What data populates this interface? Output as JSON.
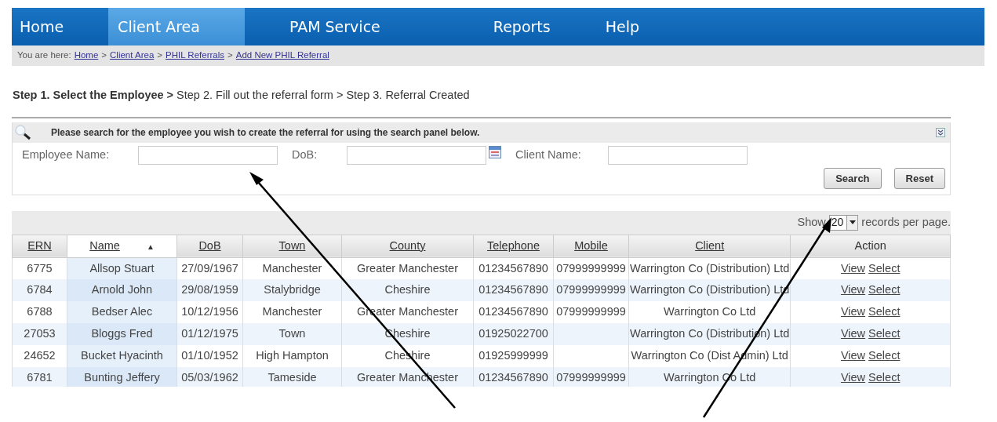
{
  "nav": [
    {
      "label": "Home",
      "selected": false
    },
    {
      "label": "Client Area",
      "selected": true
    },
    {
      "label": "PAM Service",
      "selected": false
    },
    {
      "label": "Reports",
      "selected": false
    },
    {
      "label": "Help",
      "selected": false
    }
  ],
  "breadcrumb": {
    "prefix": "You are here:",
    "separator": ">",
    "links": [
      "Home",
      "Client Area",
      "PHIL Referrals",
      "Add New PHIL Referral"
    ]
  },
  "steps": [
    {
      "label": "Step 1. Select the Employee",
      "current": true
    },
    {
      "label": "Step 2. Fill out the referral form",
      "current": false
    },
    {
      "label": "Step 3. Referral Created",
      "current": false
    }
  ],
  "step_separator": ">",
  "search_panel": {
    "title": "Please search for the employee you wish to create the referral for using the search panel below.",
    "fields": [
      {
        "label": "Employee Name:",
        "kind": "text"
      },
      {
        "label": "DoB:",
        "kind": "date"
      },
      {
        "label": "Client Name:",
        "kind": "text"
      }
    ],
    "buttons": [
      "Search",
      "Reset"
    ]
  },
  "paging": {
    "prefix": "Show",
    "value": "20",
    "suffix": "records per page."
  },
  "table": {
    "columns": [
      {
        "label": "ERN",
        "sorted": false,
        "link": true
      },
      {
        "label": "Name",
        "sorted": true,
        "sort_indicator": "▲",
        "link": true
      },
      {
        "label": "DoB",
        "sorted": false,
        "link": true
      },
      {
        "label": "Town",
        "sorted": false,
        "link": true
      },
      {
        "label": "County",
        "sorted": false,
        "link": true
      },
      {
        "label": "Telephone",
        "sorted": false,
        "link": true
      },
      {
        "label": "Mobile",
        "sorted": false,
        "link": true
      },
      {
        "label": "Client",
        "sorted": false,
        "link": true
      },
      {
        "label": "Action",
        "sorted": false,
        "link": false
      }
    ],
    "rows": [
      {
        "cells": [
          "6775",
          "Allsop Stuart",
          "27/09/1967",
          "Manchester",
          "Greater Manchester",
          "01234567890",
          "07999999999",
          "Warrington Co (Distribution) Ltd"
        ],
        "actions": [
          "View",
          "Select"
        ]
      },
      {
        "cells": [
          "6784",
          "Arnold John",
          "29/08/1959",
          "Stalybridge",
          "Cheshire",
          "01234567890",
          "07999999999",
          "Warrington Co (Distribution) Ltd"
        ],
        "actions": [
          "View",
          "Select"
        ]
      },
      {
        "cells": [
          "6788",
          "Bedser Alec",
          "10/12/1956",
          "Manchester",
          "Greater Manchester",
          "01234567890",
          "07999999999",
          "Warrington Co Ltd"
        ],
        "actions": [
          "View",
          "Select"
        ]
      },
      {
        "cells": [
          "27053",
          "Bloggs Fred",
          "01/12/1975",
          "Town",
          "Cheshire",
          "01925022700",
          "",
          "Warrington Co (Distribution) Ltd"
        ],
        "actions": [
          "View",
          "Select"
        ]
      },
      {
        "cells": [
          "24652",
          "Bucket Hyacinth",
          "01/10/1952",
          "High Hampton",
          "Cheshire",
          "01925999999",
          "",
          "Warrington Co (Dist Admin) Ltd"
        ],
        "actions": [
          "View",
          "Select"
        ]
      },
      {
        "cells": [
          "6781",
          "Bunting Jeffery",
          "05/03/1962",
          "Tameside",
          "Greater Manchester",
          "01234567890",
          "07999999999",
          "Warrington Co Ltd"
        ],
        "actions": [
          "View",
          "Select"
        ]
      }
    ]
  }
}
